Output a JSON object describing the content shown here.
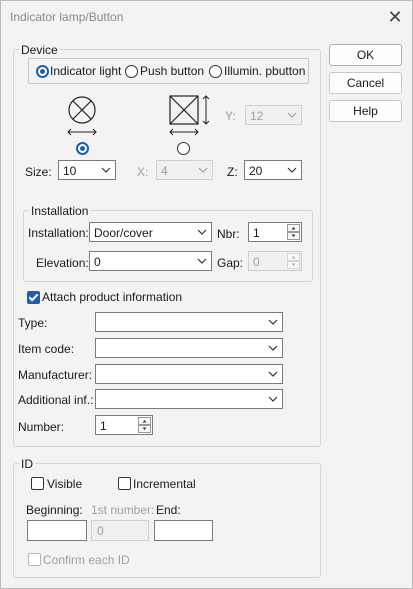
{
  "window": {
    "title": "Indicator lamp/Button",
    "close_glyph": "✕"
  },
  "buttons": {
    "ok": "OK",
    "cancel": "Cancel",
    "help": "Help"
  },
  "device": {
    "legend": "Device",
    "type_options": [
      "Indicator light",
      "Push button",
      "Illumin. pbutton"
    ],
    "selected_type": "Indicator light",
    "symbol_left_icon": "lamp-cross-circle-icon",
    "symbol_right_icon": "box-cross-dimension-icon",
    "size_label": "Size:",
    "size_value": "10",
    "x_label": "X:",
    "x_value": "4",
    "y_label": "Y:",
    "y_value": "12",
    "z_label": "Z:",
    "z_value": "20"
  },
  "installation": {
    "legend": "Installation",
    "installation_label": "Installation:",
    "installation_value": "Door/cover",
    "nbr_label": "Nbr:",
    "nbr_value": "1",
    "elevation_label": "Elevation:",
    "elevation_value": "0",
    "gap_label": "Gap:",
    "gap_value": "0"
  },
  "product": {
    "attach_label": "Attach product information",
    "attach_checked": true,
    "type_label": "Type:",
    "type_value": "",
    "item_code_label": "Item code:",
    "item_code_value": "",
    "manufacturer_label": "Manufacturer:",
    "manufacturer_value": "",
    "additional_label": "Additional inf.:",
    "additional_value": "",
    "number_label": "Number:",
    "number_value": "1"
  },
  "id": {
    "legend": "ID",
    "visible_label": "Visible",
    "incremental_label": "Incremental",
    "beginning_label": "Beginning:",
    "first_number_label": "1st number:",
    "first_number_value": "0",
    "end_label": "End:",
    "confirm_label": "Confirm each ID"
  }
}
